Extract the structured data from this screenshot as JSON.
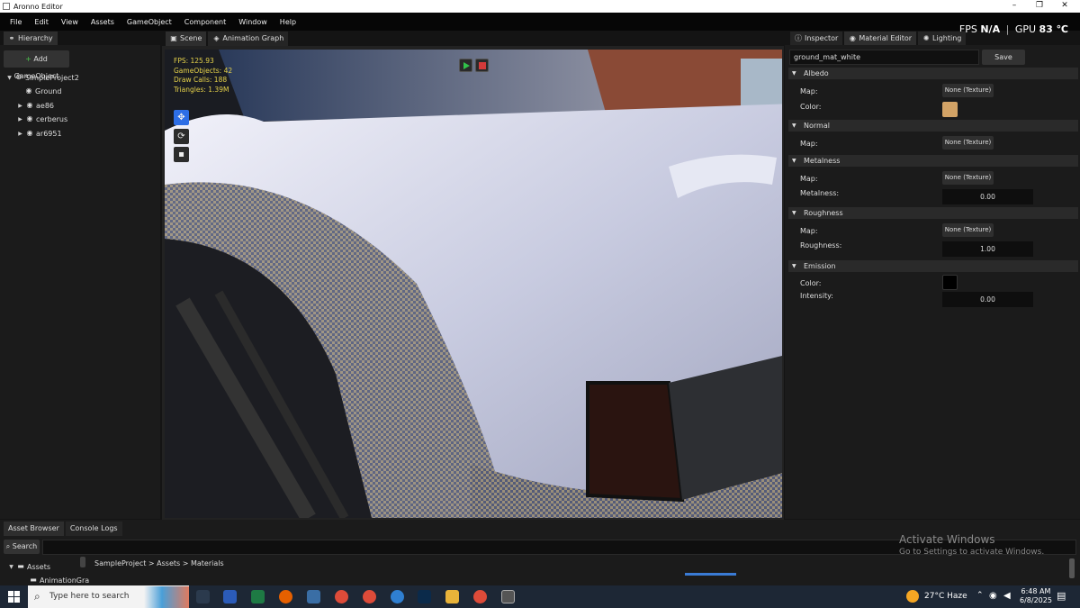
{
  "window": {
    "title": "Aronno Editor",
    "minimize": "–",
    "restore": "❐",
    "close": "✕"
  },
  "menu": [
    "File",
    "Edit",
    "View",
    "Assets",
    "GameObject",
    "Component",
    "Window",
    "Help"
  ],
  "perf": {
    "fps_label": "FPS",
    "fps_value": "N/A",
    "sep": "|",
    "gpu_label": "GPU",
    "gpu_value": "83 ℃"
  },
  "hierarchy": {
    "tab": "Hierarchy",
    "add_button": "Add GameObject",
    "items": [
      {
        "label": "SimpleProject2"
      },
      {
        "label": "Ground"
      },
      {
        "label": "ae86"
      },
      {
        "label": "cerberus"
      },
      {
        "label": "ar6951"
      }
    ]
  },
  "center_tabs": [
    "Scene",
    "Animation Graph"
  ],
  "viewport_stats": {
    "fps": "FPS: 125.93",
    "gameobjects": "GameObjects: 42",
    "drawcalls": "Draw Calls: 188",
    "triangles": "Triangles: 1.39M"
  },
  "inspector": {
    "tabs": [
      "Inspector",
      "Material Editor",
      "Lighting"
    ],
    "material_name": "ground_mat_white",
    "save": "Save",
    "sections": {
      "albedo": {
        "title": "Albedo",
        "map_label": "Map:",
        "map_value": "None (Texture)",
        "color_label": "Color:",
        "color": "#d3a366"
      },
      "normal": {
        "title": "Normal",
        "map_label": "Map:",
        "map_value": "None (Texture)"
      },
      "metalness": {
        "title": "Metalness",
        "map_label": "Map:",
        "map_value": "None (Texture)",
        "value_label": "Metalness:",
        "value": "0.00"
      },
      "roughness": {
        "title": "Roughness",
        "map_label": "Map:",
        "map_value": "None (Texture)",
        "value_label": "Roughness:",
        "value": "1.00"
      },
      "emission": {
        "title": "Emission",
        "color_label": "Color:",
        "color": "#000000",
        "intensity_label": "Intensity:",
        "intensity": "0.00"
      }
    }
  },
  "bottom": {
    "tabs": [
      "Asset Browser",
      "Console Logs"
    ],
    "search_label": "Search",
    "tree_root": "Assets",
    "tree_child": "AnimationGra",
    "breadcrumb": "SampleProject > Assets > Materials"
  },
  "watermark": {
    "line1": "Activate Windows",
    "line2": "Go to Settings to activate Windows."
  },
  "taskbar": {
    "search": "Type here to search",
    "weather": "27°C  Haze",
    "time": "6:48 AM",
    "date": "6/8/2025"
  }
}
